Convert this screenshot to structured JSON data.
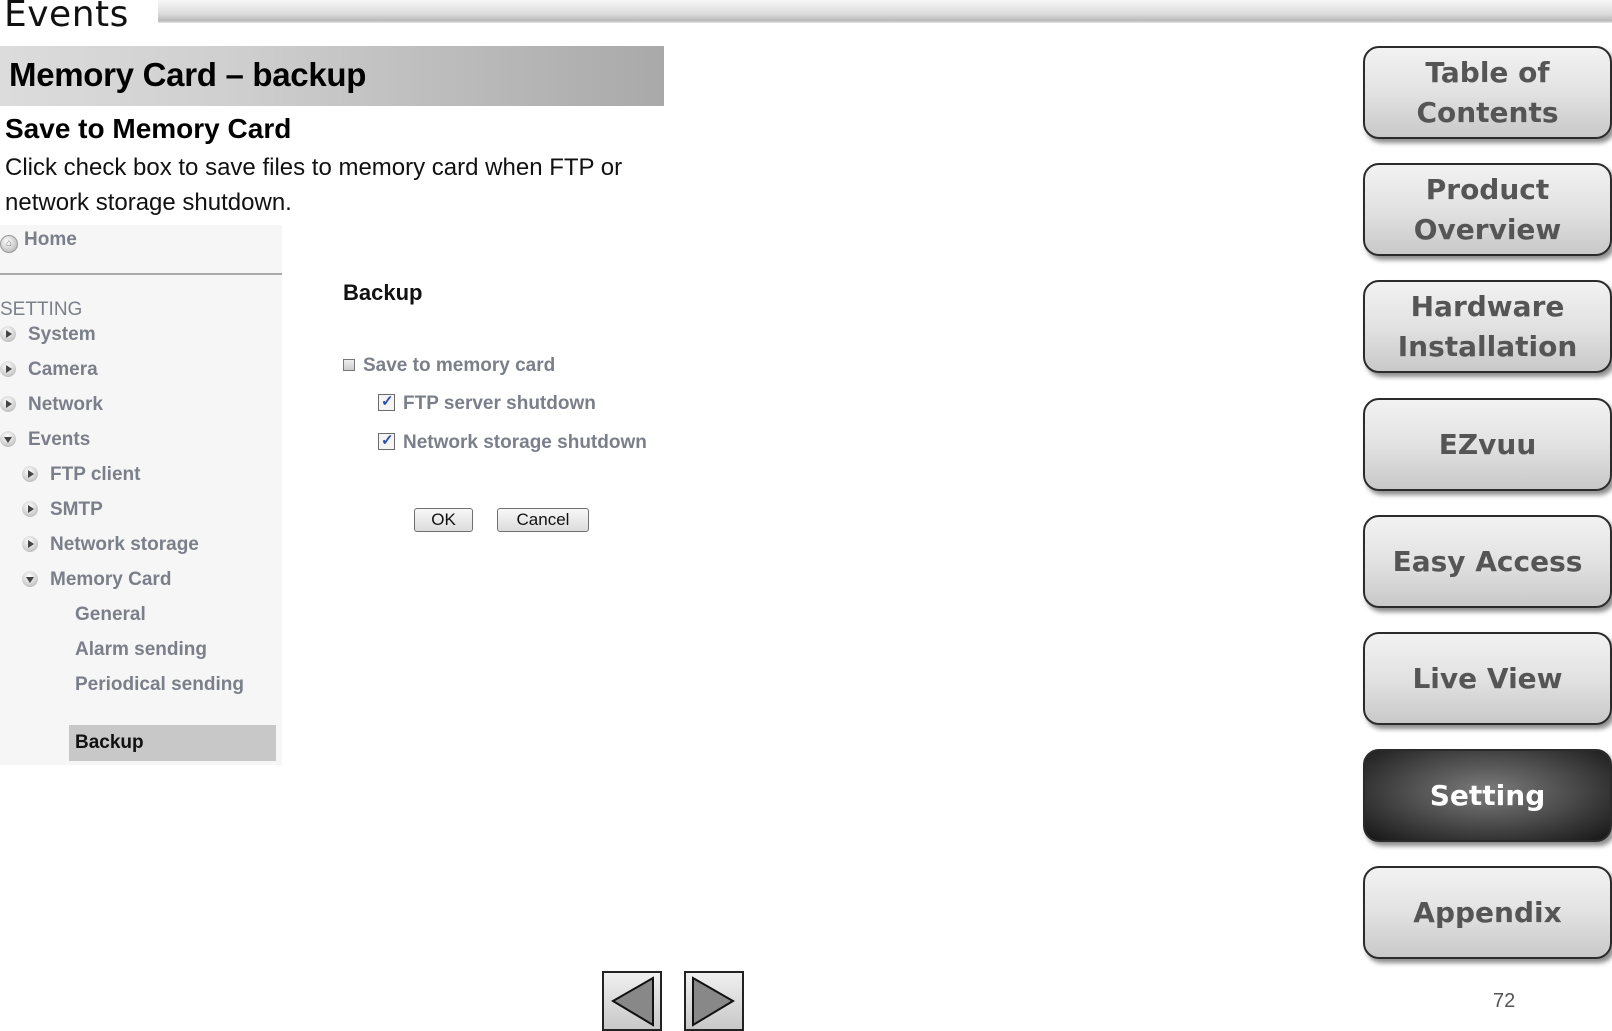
{
  "page": {
    "section_title": "Events",
    "heading": "Memory Card – backup",
    "sub_heading": "Save to Memory Card",
    "description": "Click check box to save files to memory card when FTP or network storage shutdown.",
    "page_number": "72"
  },
  "screenshot": {
    "nav": {
      "home": "Home",
      "setting_label": "SETTING",
      "items": [
        {
          "label": "System",
          "level": 0,
          "state": "collapsed"
        },
        {
          "label": "Camera",
          "level": 0,
          "state": "collapsed"
        },
        {
          "label": "Network",
          "level": 0,
          "state": "collapsed"
        },
        {
          "label": "Events",
          "level": 0,
          "state": "expanded"
        },
        {
          "label": "FTP client",
          "level": 1,
          "state": "collapsed"
        },
        {
          "label": "SMTP",
          "level": 1,
          "state": "collapsed"
        },
        {
          "label": "Network storage",
          "level": 1,
          "state": "collapsed"
        },
        {
          "label": "Memory Card",
          "level": 1,
          "state": "expanded"
        },
        {
          "label": "General",
          "level": 2,
          "state": "leaf"
        },
        {
          "label": "Alarm sending",
          "level": 2,
          "state": "leaf"
        },
        {
          "label": "Periodical sending",
          "level": 2,
          "state": "leaf"
        },
        {
          "label": "Backup",
          "level": 2,
          "state": "selected"
        }
      ]
    },
    "form": {
      "title": "Backup",
      "save_to_memory_card": {
        "label": "Save to memory card",
        "checked": false
      },
      "ftp_server_shutdown": {
        "label": "FTP server shutdown",
        "checked": true
      },
      "network_storage_shutdown": {
        "label": "Network storage shutdown",
        "checked": true
      },
      "ok_label": "OK",
      "cancel_label": "Cancel"
    }
  },
  "side_nav": [
    {
      "label": "Table of Contents",
      "active": false
    },
    {
      "label": "Product Overview",
      "active": false
    },
    {
      "label": "Hardware Installation",
      "active": false
    },
    {
      "label": "EZvuu",
      "active": false
    },
    {
      "label": "Easy Access",
      "active": false
    },
    {
      "label": "Live View",
      "active": false
    },
    {
      "label": "Setting",
      "active": true
    },
    {
      "label": "Appendix",
      "active": false
    }
  ],
  "pager": {
    "prev_icon": "triangle-left",
    "next_icon": "triangle-right"
  }
}
